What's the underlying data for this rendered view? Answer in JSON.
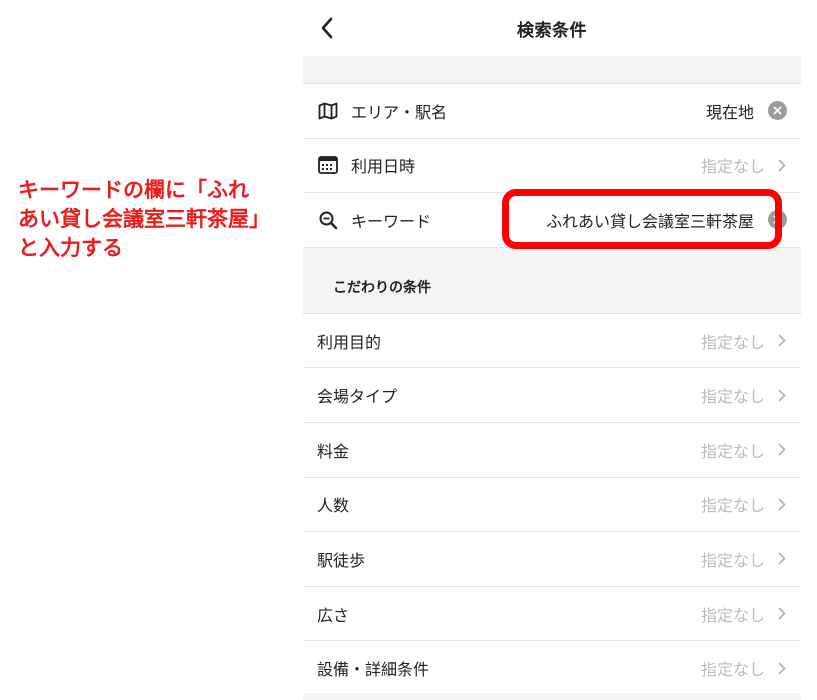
{
  "annotation": {
    "line1": "キーワードの欄に「ふれ",
    "line2": "あい貸し会議室三軒茶屋」",
    "line3": "と入力する"
  },
  "header": {
    "title": "検索条件",
    "back_icon": "chevron-left-icon"
  },
  "basic_rows": [
    {
      "icon": "map-icon",
      "label": "エリア・駅名",
      "value": "現在地",
      "action": "clear-icon"
    },
    {
      "icon": "calendar-icon",
      "label": "利用日時",
      "value": "指定なし",
      "action": "chevron-right-icon"
    },
    {
      "icon": "search-icon",
      "label": "キーワード",
      "value": "ふれあい貸し会議室三軒茶屋",
      "action": "clear-icon"
    }
  ],
  "section": {
    "title": "こだわりの条件"
  },
  "filter_rows": [
    {
      "label": "利用目的",
      "value": "指定なし"
    },
    {
      "label": "会場タイプ",
      "value": "指定なし"
    },
    {
      "label": "料金",
      "value": "指定なし"
    },
    {
      "label": "人数",
      "value": "指定なし"
    },
    {
      "label": "駅徒歩",
      "value": "指定なし"
    },
    {
      "label": "広さ",
      "value": "指定なし"
    },
    {
      "label": "設備・詳細条件",
      "value": "指定なし"
    }
  ],
  "colors": {
    "annotation": "#ea1d1d",
    "highlight": "#ff0000",
    "placeholder": "#bcbcbc",
    "section_bg": "#f4f4f4"
  }
}
